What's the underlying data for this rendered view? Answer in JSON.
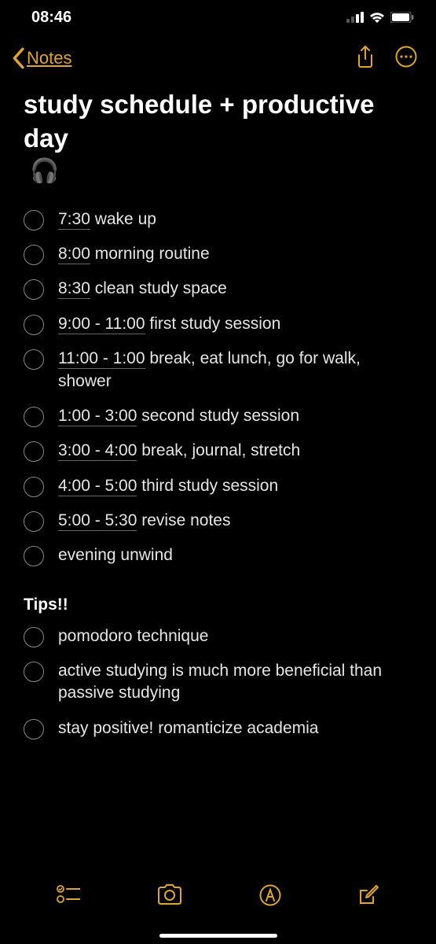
{
  "status": {
    "time": "08:46"
  },
  "nav": {
    "back_label": "Notes"
  },
  "note": {
    "title_text": "study schedule + productive day",
    "title_emoji": "🎧",
    "tips_heading": "Tips!!",
    "schedule": [
      {
        "time": "7:30",
        "text": " wake up"
      },
      {
        "time": "8:00",
        "text": " morning routine"
      },
      {
        "time": "8:30",
        "text": " clean study space"
      },
      {
        "time": "9:00 - 11:00",
        "text": " first study session"
      },
      {
        "time": "11:00 - 1:00",
        "text": " break, eat lunch, go for walk, shower"
      },
      {
        "time": "1:00 - 3:00",
        "text": " second study session"
      },
      {
        "time": "3:00 - 4:00",
        "text": " break, journal, stretch"
      },
      {
        "time": "4:00 - 5:00",
        "text": " third study session"
      },
      {
        "time": "5:00 - 5:30",
        "text": " revise notes"
      },
      {
        "time": "",
        "text": "evening unwind"
      }
    ],
    "tips": [
      {
        "text": "pomodoro technique"
      },
      {
        "text": "active studying is much more beneficial than passive studying"
      },
      {
        "text": "stay positive! romanticize academia"
      }
    ]
  }
}
